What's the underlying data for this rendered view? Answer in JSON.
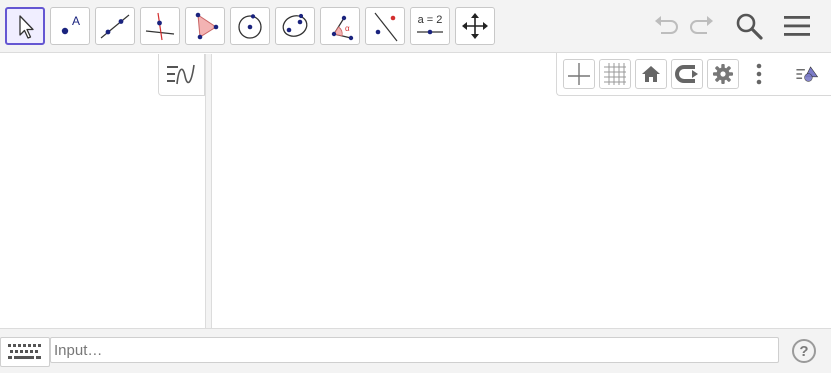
{
  "toolbar": {
    "tools": [
      {
        "id": "move",
        "icon": "cursor-arrow-icon"
      },
      {
        "id": "point",
        "icon": "point-icon",
        "label_glyph": "A"
      },
      {
        "id": "line",
        "icon": "line-through-points-icon"
      },
      {
        "id": "perpendicular",
        "icon": "perpendicular-line-icon"
      },
      {
        "id": "polygon",
        "icon": "polygon-icon"
      },
      {
        "id": "circle",
        "icon": "circle-center-point-icon"
      },
      {
        "id": "ellipse",
        "icon": "ellipse-icon"
      },
      {
        "id": "angle",
        "icon": "angle-icon",
        "label_glyph": "α"
      },
      {
        "id": "reflect",
        "icon": "reflect-about-line-icon"
      },
      {
        "id": "slider",
        "icon": "slider-icon",
        "label_glyph": "a = 2"
      },
      {
        "id": "move-graphics",
        "icon": "move-graphics-view-icon"
      }
    ],
    "selected_tool": "move",
    "right_buttons": [
      "undo-icon",
      "redo-icon",
      "search-icon",
      "menu-icon"
    ]
  },
  "algebra_view": {
    "style_button_icon": "algebra-style-icon"
  },
  "graphics_style_bar": {
    "buttons": [
      "axes-icon",
      "grid-icon",
      "home-icon",
      "point-capturing-icon",
      "settings-gear-icon",
      "more-vertical-icon",
      "style-bar-toggle-icon"
    ]
  },
  "input_bar": {
    "placeholder": "Input…",
    "help_label": "?"
  },
  "colors": {
    "selected_border": "#6557d2",
    "point_blue": "#1a237e",
    "accent_red": "#d32f2f",
    "polygon_fill": "#f3b3b3"
  }
}
